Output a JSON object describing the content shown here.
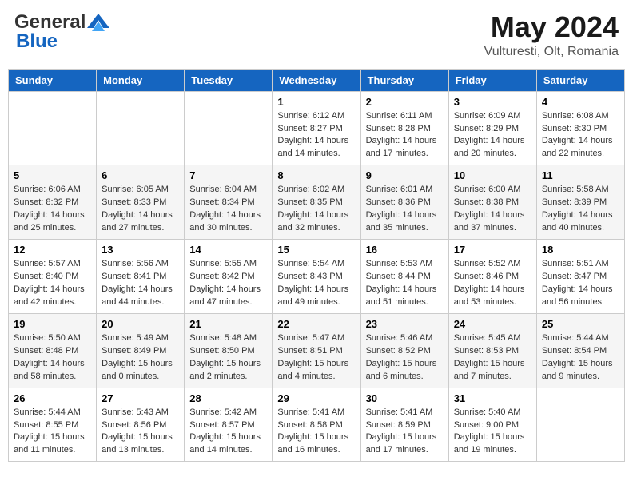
{
  "header": {
    "logo_general": "General",
    "logo_blue": "Blue",
    "month_year": "May 2024",
    "location": "Vulturesti, Olt, Romania"
  },
  "weekdays": [
    "Sunday",
    "Monday",
    "Tuesday",
    "Wednesday",
    "Thursday",
    "Friday",
    "Saturday"
  ],
  "weeks": [
    [
      {
        "day": "",
        "sunrise": "",
        "sunset": "",
        "daylight": ""
      },
      {
        "day": "",
        "sunrise": "",
        "sunset": "",
        "daylight": ""
      },
      {
        "day": "",
        "sunrise": "",
        "sunset": "",
        "daylight": ""
      },
      {
        "day": "1",
        "sunrise": "Sunrise: 6:12 AM",
        "sunset": "Sunset: 8:27 PM",
        "daylight": "Daylight: 14 hours and 14 minutes."
      },
      {
        "day": "2",
        "sunrise": "Sunrise: 6:11 AM",
        "sunset": "Sunset: 8:28 PM",
        "daylight": "Daylight: 14 hours and 17 minutes."
      },
      {
        "day": "3",
        "sunrise": "Sunrise: 6:09 AM",
        "sunset": "Sunset: 8:29 PM",
        "daylight": "Daylight: 14 hours and 20 minutes."
      },
      {
        "day": "4",
        "sunrise": "Sunrise: 6:08 AM",
        "sunset": "Sunset: 8:30 PM",
        "daylight": "Daylight: 14 hours and 22 minutes."
      }
    ],
    [
      {
        "day": "5",
        "sunrise": "Sunrise: 6:06 AM",
        "sunset": "Sunset: 8:32 PM",
        "daylight": "Daylight: 14 hours and 25 minutes."
      },
      {
        "day": "6",
        "sunrise": "Sunrise: 6:05 AM",
        "sunset": "Sunset: 8:33 PM",
        "daylight": "Daylight: 14 hours and 27 minutes."
      },
      {
        "day": "7",
        "sunrise": "Sunrise: 6:04 AM",
        "sunset": "Sunset: 8:34 PM",
        "daylight": "Daylight: 14 hours and 30 minutes."
      },
      {
        "day": "8",
        "sunrise": "Sunrise: 6:02 AM",
        "sunset": "Sunset: 8:35 PM",
        "daylight": "Daylight: 14 hours and 32 minutes."
      },
      {
        "day": "9",
        "sunrise": "Sunrise: 6:01 AM",
        "sunset": "Sunset: 8:36 PM",
        "daylight": "Daylight: 14 hours and 35 minutes."
      },
      {
        "day": "10",
        "sunrise": "Sunrise: 6:00 AM",
        "sunset": "Sunset: 8:38 PM",
        "daylight": "Daylight: 14 hours and 37 minutes."
      },
      {
        "day": "11",
        "sunrise": "Sunrise: 5:58 AM",
        "sunset": "Sunset: 8:39 PM",
        "daylight": "Daylight: 14 hours and 40 minutes."
      }
    ],
    [
      {
        "day": "12",
        "sunrise": "Sunrise: 5:57 AM",
        "sunset": "Sunset: 8:40 PM",
        "daylight": "Daylight: 14 hours and 42 minutes."
      },
      {
        "day": "13",
        "sunrise": "Sunrise: 5:56 AM",
        "sunset": "Sunset: 8:41 PM",
        "daylight": "Daylight: 14 hours and 44 minutes."
      },
      {
        "day": "14",
        "sunrise": "Sunrise: 5:55 AM",
        "sunset": "Sunset: 8:42 PM",
        "daylight": "Daylight: 14 hours and 47 minutes."
      },
      {
        "day": "15",
        "sunrise": "Sunrise: 5:54 AM",
        "sunset": "Sunset: 8:43 PM",
        "daylight": "Daylight: 14 hours and 49 minutes."
      },
      {
        "day": "16",
        "sunrise": "Sunrise: 5:53 AM",
        "sunset": "Sunset: 8:44 PM",
        "daylight": "Daylight: 14 hours and 51 minutes."
      },
      {
        "day": "17",
        "sunrise": "Sunrise: 5:52 AM",
        "sunset": "Sunset: 8:46 PM",
        "daylight": "Daylight: 14 hours and 53 minutes."
      },
      {
        "day": "18",
        "sunrise": "Sunrise: 5:51 AM",
        "sunset": "Sunset: 8:47 PM",
        "daylight": "Daylight: 14 hours and 56 minutes."
      }
    ],
    [
      {
        "day": "19",
        "sunrise": "Sunrise: 5:50 AM",
        "sunset": "Sunset: 8:48 PM",
        "daylight": "Daylight: 14 hours and 58 minutes."
      },
      {
        "day": "20",
        "sunrise": "Sunrise: 5:49 AM",
        "sunset": "Sunset: 8:49 PM",
        "daylight": "Daylight: 15 hours and 0 minutes."
      },
      {
        "day": "21",
        "sunrise": "Sunrise: 5:48 AM",
        "sunset": "Sunset: 8:50 PM",
        "daylight": "Daylight: 15 hours and 2 minutes."
      },
      {
        "day": "22",
        "sunrise": "Sunrise: 5:47 AM",
        "sunset": "Sunset: 8:51 PM",
        "daylight": "Daylight: 15 hours and 4 minutes."
      },
      {
        "day": "23",
        "sunrise": "Sunrise: 5:46 AM",
        "sunset": "Sunset: 8:52 PM",
        "daylight": "Daylight: 15 hours and 6 minutes."
      },
      {
        "day": "24",
        "sunrise": "Sunrise: 5:45 AM",
        "sunset": "Sunset: 8:53 PM",
        "daylight": "Daylight: 15 hours and 7 minutes."
      },
      {
        "day": "25",
        "sunrise": "Sunrise: 5:44 AM",
        "sunset": "Sunset: 8:54 PM",
        "daylight": "Daylight: 15 hours and 9 minutes."
      }
    ],
    [
      {
        "day": "26",
        "sunrise": "Sunrise: 5:44 AM",
        "sunset": "Sunset: 8:55 PM",
        "daylight": "Daylight: 15 hours and 11 minutes."
      },
      {
        "day": "27",
        "sunrise": "Sunrise: 5:43 AM",
        "sunset": "Sunset: 8:56 PM",
        "daylight": "Daylight: 15 hours and 13 minutes."
      },
      {
        "day": "28",
        "sunrise": "Sunrise: 5:42 AM",
        "sunset": "Sunset: 8:57 PM",
        "daylight": "Daylight: 15 hours and 14 minutes."
      },
      {
        "day": "29",
        "sunrise": "Sunrise: 5:41 AM",
        "sunset": "Sunset: 8:58 PM",
        "daylight": "Daylight: 15 hours and 16 minutes."
      },
      {
        "day": "30",
        "sunrise": "Sunrise: 5:41 AM",
        "sunset": "Sunset: 8:59 PM",
        "daylight": "Daylight: 15 hours and 17 minutes."
      },
      {
        "day": "31",
        "sunrise": "Sunrise: 5:40 AM",
        "sunset": "Sunset: 9:00 PM",
        "daylight": "Daylight: 15 hours and 19 minutes."
      },
      {
        "day": "",
        "sunrise": "",
        "sunset": "",
        "daylight": ""
      }
    ]
  ]
}
